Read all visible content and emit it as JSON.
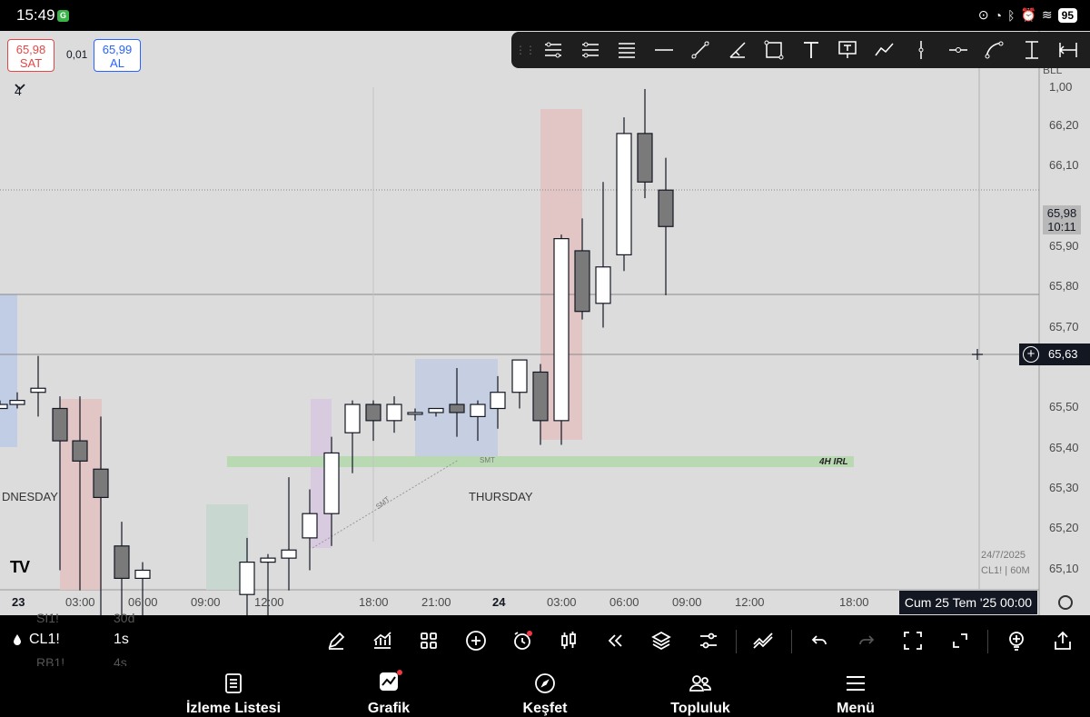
{
  "status_bar": {
    "time": "15:49",
    "battery": "95"
  },
  "trade": {
    "sell_price": "65,98",
    "sell_label": "SAT",
    "spread": "0,01",
    "buy_price": "65,99",
    "buy_label": "AL"
  },
  "legend": {
    "count": "4"
  },
  "drawing_tools": [
    "horizontal-ray-icon",
    "parallel-channel-icon",
    "fib-retracement-icon",
    "horizontal-line-icon",
    "trend-line-icon",
    "brush-icon",
    "rectangle-icon",
    "text-icon",
    "callout-icon",
    "path-icon",
    "vertical-line-icon",
    "cross-line-icon",
    "curve-icon",
    "anchor-icon",
    "measure-icon"
  ],
  "chart": {
    "symbol_code": "BLL",
    "price_ticks": [
      "66,20",
      "66,10",
      "66,00",
      "65,90",
      "65,80",
      "65,70",
      "65,60",
      "65,50",
      "65,40",
      "65,30",
      "65,20",
      "65,10"
    ],
    "top_tick": "1,00",
    "last_price": "65,98",
    "countdown": "10:11",
    "crosshair_price": "65,63",
    "crosshair_time": "Cum 25 Tem '25   00:00",
    "time_ticks": [
      {
        "label": "23",
        "bold": true
      },
      {
        "label": "03:00"
      },
      {
        "label": "06:00"
      },
      {
        "label": "09:00"
      },
      {
        "label": "12:00"
      },
      {
        "label": "18:00"
      },
      {
        "label": "21:00"
      },
      {
        "label": "24",
        "bold": true
      },
      {
        "label": "03:00"
      },
      {
        "label": "06:00"
      },
      {
        "label": "09:00"
      },
      {
        "label": "12:00"
      },
      {
        "label": "18:00"
      }
    ],
    "day_labels": [
      "DNESDAY",
      "THURSDAY"
    ],
    "zone_label": "4H IRL",
    "smt_labels": [
      "SMT",
      "SMT"
    ],
    "info_date": "24/7/2025",
    "info_symbol": "CL1! | 60M",
    "logo": "TV"
  },
  "chart_data": {
    "type": "candlestick",
    "series": [
      {
        "name": "CL1!",
        "ohlc": [
          [
            65.5,
            65.52,
            65.5,
            65.51
          ],
          [
            65.51,
            65.54,
            65.5,
            65.52
          ],
          [
            65.54,
            65.63,
            65.48,
            65.55
          ],
          [
            65.5,
            65.53,
            65.1,
            65.42
          ],
          [
            65.42,
            65.53,
            65.05,
            65.37
          ],
          [
            65.35,
            65.48,
            64.98,
            65.28
          ],
          [
            65.16,
            65.22,
            64.9,
            65.08
          ],
          [
            65.08,
            65.12,
            64.95,
            65.1
          ],
          [
            65.04,
            65.18,
            64.92,
            65.12
          ],
          [
            65.12,
            65.14,
            64.98,
            65.13
          ],
          [
            65.13,
            65.33,
            65.05,
            65.15
          ],
          [
            65.18,
            65.3,
            65.1,
            65.24
          ],
          [
            65.24,
            65.43,
            65.16,
            65.39
          ],
          [
            65.44,
            65.52,
            65.34,
            65.51
          ],
          [
            65.51,
            65.52,
            65.42,
            65.47
          ],
          [
            65.47,
            65.53,
            65.44,
            65.51
          ],
          [
            65.49,
            65.5,
            65.47,
            65.49
          ],
          [
            65.49,
            65.5,
            65.48,
            65.5
          ],
          [
            65.51,
            65.6,
            65.43,
            65.49
          ],
          [
            65.48,
            65.52,
            65.42,
            65.51
          ],
          [
            65.5,
            65.58,
            65.45,
            65.54
          ],
          [
            65.54,
            65.61,
            65.5,
            65.62
          ],
          [
            65.59,
            65.61,
            65.41,
            65.47
          ],
          [
            65.47,
            65.93,
            65.41,
            65.92
          ],
          [
            65.89,
            65.97,
            65.72,
            65.74
          ],
          [
            65.76,
            66.06,
            65.7,
            65.85
          ],
          [
            65.88,
            66.22,
            65.84,
            66.18
          ],
          [
            66.18,
            66.29,
            66.02,
            66.06
          ],
          [
            66.04,
            66.12,
            65.78,
            65.95
          ],
          [
            65.8,
            66.02,
            65.63,
            65.98
          ]
        ]
      }
    ],
    "x_axis": [
      "23",
      "03:00",
      "06:00",
      "09:00",
      "12:00",
      "18:00",
      "21:00",
      "24",
      "03:00",
      "06:00",
      "09:00",
      "12:00",
      "18:00"
    ],
    "ylim": [
      65.05,
      66.25
    ],
    "grid": false
  },
  "bottom_bar": {
    "symbol": "CL1!",
    "interval": "1s",
    "ghost_top": [
      "SI1!",
      "30d"
    ],
    "ghost_bottom": [
      "RB1!",
      "4s"
    ]
  },
  "nav": {
    "watchlist": "İzleme Listesi",
    "chart": "Grafik",
    "explore": "Keşfet",
    "community": "Topluluk",
    "menu": "Menü"
  }
}
